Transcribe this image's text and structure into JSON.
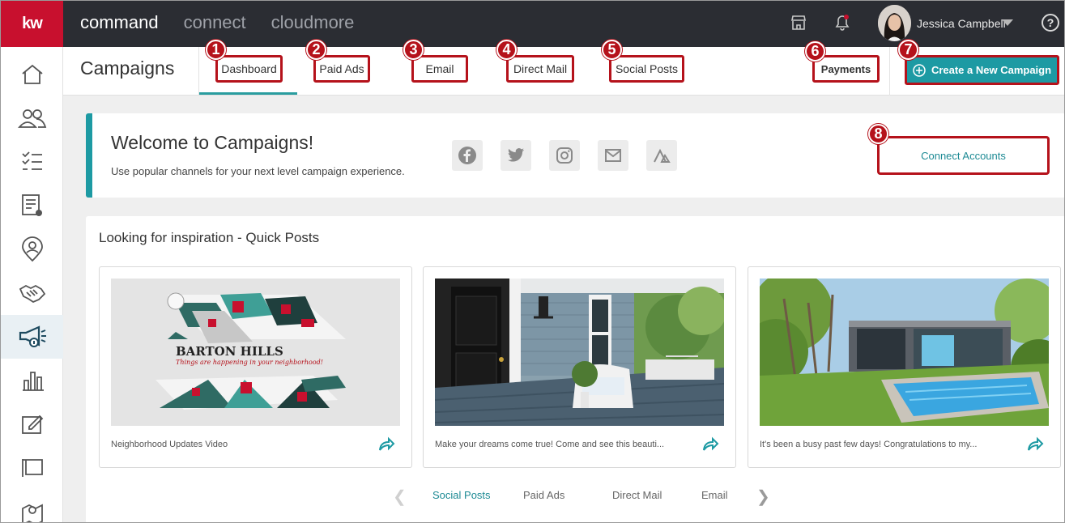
{
  "topbar": {
    "logo": "kw",
    "nav": [
      "command",
      "connect",
      "cloudmore"
    ],
    "user_name": "Jessica Campbell",
    "help": "?"
  },
  "sidebar": {
    "items": [
      "home-icon",
      "contacts-icon",
      "tasks-icon",
      "reports-icon",
      "pin-person-icon",
      "handshake-icon",
      "megaphone-icon",
      "bar-chart-icon",
      "edit-icon",
      "presentation-icon",
      "map-pin-icon"
    ]
  },
  "header": {
    "title": "Campaigns",
    "tabs": [
      {
        "badge": "1",
        "label": "Dashboard"
      },
      {
        "badge": "2",
        "label": "Paid Ads"
      },
      {
        "badge": "3",
        "label": "Email"
      },
      {
        "badge": "4",
        "label": "Direct Mail"
      },
      {
        "badge": "5",
        "label": "Social Posts"
      },
      {
        "badge": "6",
        "label": "Payments"
      }
    ],
    "create_badge": "7",
    "create_label": "Create a New Campaign"
  },
  "welcome": {
    "title": "Welcome to Campaigns!",
    "subtitle": "Use popular channels for your next level campaign experience.",
    "channels": [
      "facebook-icon",
      "twitter-icon",
      "instagram-icon",
      "mail-icon",
      "ads-icon"
    ],
    "connect_badge": "8",
    "connect_label": "Connect Accounts"
  },
  "inspiration": {
    "title": "Looking for inspiration - Quick Posts",
    "posts": [
      {
        "caption": "Neighborhood Updates Video",
        "image_title": "BARTON HILLS",
        "image_subtitle": "Things are happening in your neighborhood!"
      },
      {
        "caption": "Make your dreams come true! Come and see this beauti..."
      },
      {
        "caption": "It's been a busy past few days! Congratulations to my..."
      }
    ],
    "filters": [
      "Social Posts",
      "Paid Ads",
      "Direct Mail",
      "Email"
    ],
    "active_filter": "Social Posts"
  },
  "colors": {
    "brand_red": "#c8102e",
    "annotation_red": "#b5121b",
    "teal": "#1d9aa3",
    "topbar": "#2b2d33"
  }
}
